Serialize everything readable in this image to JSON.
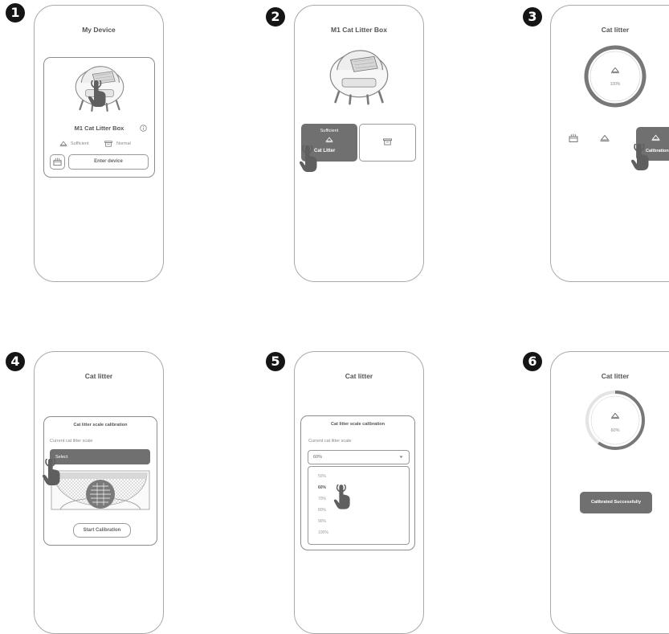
{
  "steps": [
    "1",
    "2",
    "3",
    "4",
    "5",
    "6"
  ],
  "screen1": {
    "title": "My Device",
    "device_name": "M1 Cat Litter Box",
    "litter_status": "Sufficient",
    "bin_status": "Normal",
    "enter_button": "Enter device"
  },
  "screen2": {
    "title": "M1 Cat Litter Box",
    "tile_status": "Sufficient",
    "tile_label": "Cat Litter"
  },
  "screen3": {
    "title": "Cat litter",
    "gauge_value": "100%",
    "calibration_label": "Calibration"
  },
  "screen4": {
    "title": "Cat litter",
    "card_title": "Cat litter scale calibration",
    "field_label": "Current cat litter scale",
    "select_placeholder": "Select",
    "start_button": "Start Calibration"
  },
  "screen5": {
    "title": "Cat litter",
    "card_title": "Cat litter scale calibration",
    "field_label": "Current cat litter scale",
    "selected_value": "60%",
    "options": [
      "50%",
      "60%",
      "70%",
      "80%",
      "90%",
      "100%"
    ]
  },
  "screen6": {
    "title": "Cat litter",
    "gauge_value": "60%",
    "gauge_fraction": 0.6,
    "success_button": "Calibrated Successfully"
  },
  "colors": {
    "accent": "#707070",
    "outline": "#a9a9a9",
    "step_badge": "#151515"
  }
}
